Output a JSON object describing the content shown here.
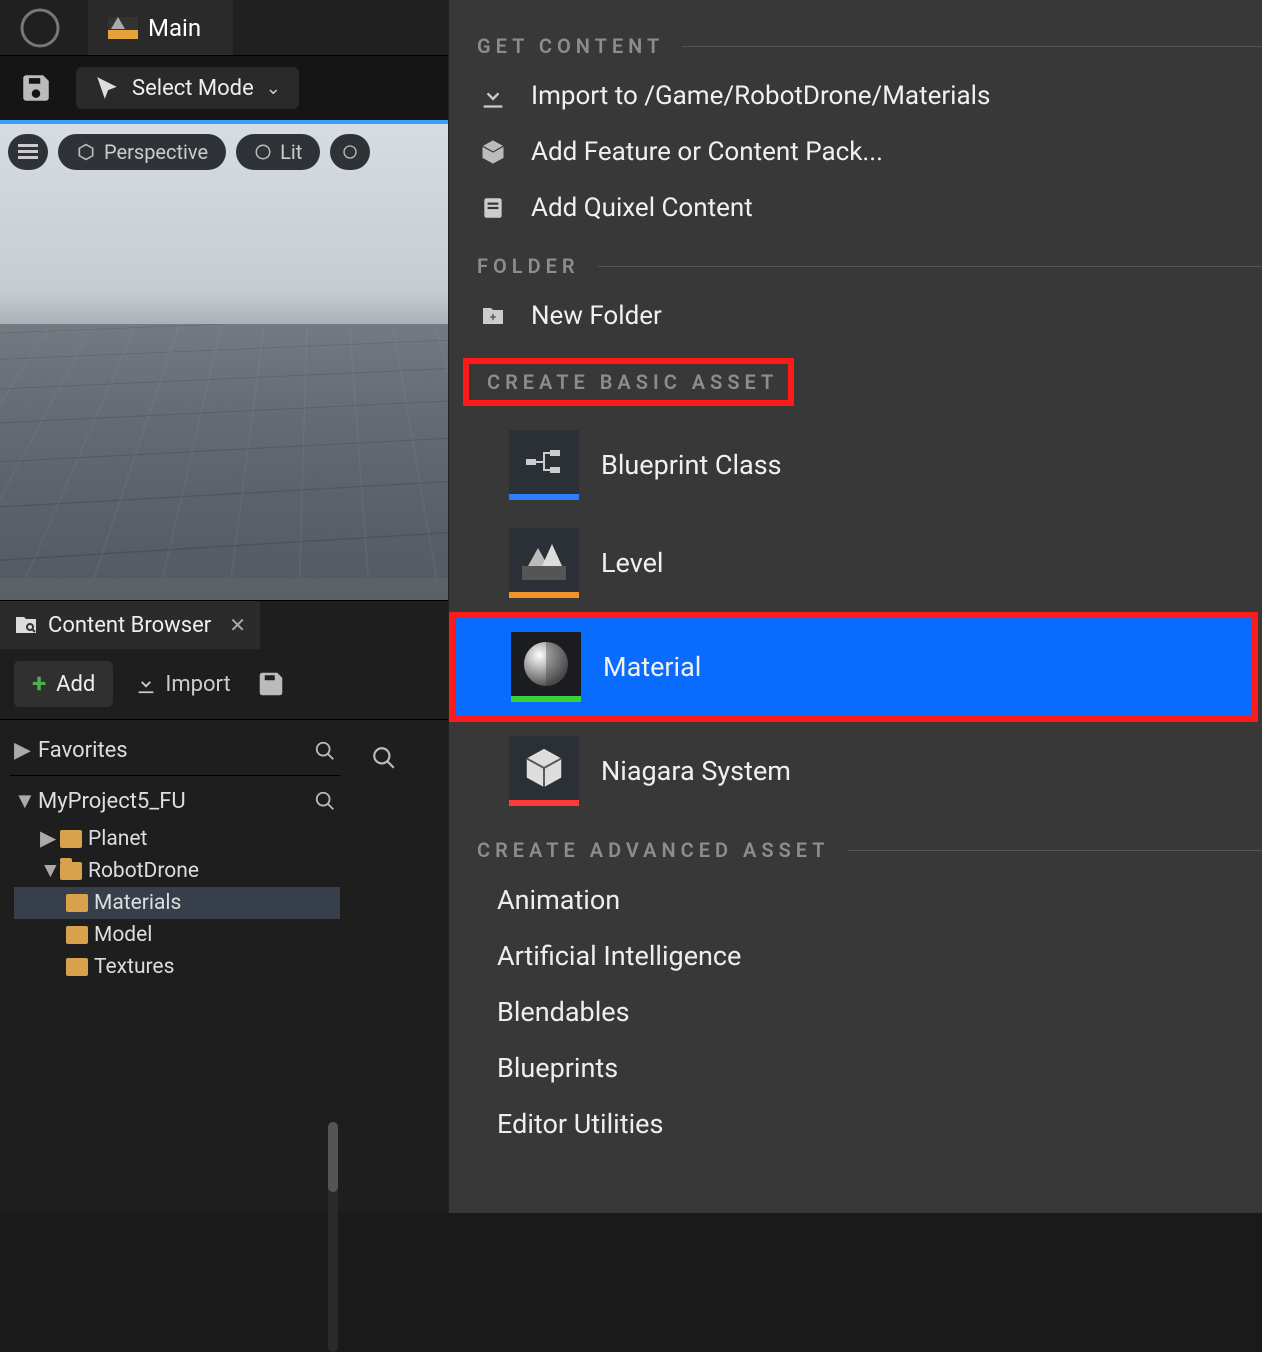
{
  "topbar": {
    "tab_label": "Main"
  },
  "toolbar": {
    "mode_label": "Select Mode"
  },
  "viewport": {
    "perspective": "Perspective",
    "lit": "Lit"
  },
  "content_browser": {
    "title": "Content Browser",
    "add": "Add",
    "import": "Import",
    "favorites": "Favorites",
    "project": "MyProject5_FU",
    "tree": {
      "planet": "Planet",
      "robotdrone": "RobotDrone",
      "materials": "Materials",
      "model": "Model",
      "textures": "Textures"
    }
  },
  "context_menu": {
    "sections": {
      "get_content": "GET CONTENT",
      "folder": "FOLDER",
      "create_basic": "CREATE BASIC ASSET",
      "create_advanced": "CREATE ADVANCED ASSET"
    },
    "get_content": {
      "import_to": "Import to /Game/RobotDrone/Materials",
      "add_pack": "Add Feature or Content Pack...",
      "quixel": "Add Quixel Content"
    },
    "folder": {
      "new_folder": "New Folder"
    },
    "basic": {
      "blueprint": "Blueprint Class",
      "level": "Level",
      "material": "Material",
      "niagara": "Niagara System"
    },
    "advanced": {
      "animation": "Animation",
      "ai": "Artificial Intelligence",
      "blendables": "Blendables",
      "blueprints": "Blueprints",
      "editor_utilities": "Editor Utilities"
    }
  }
}
